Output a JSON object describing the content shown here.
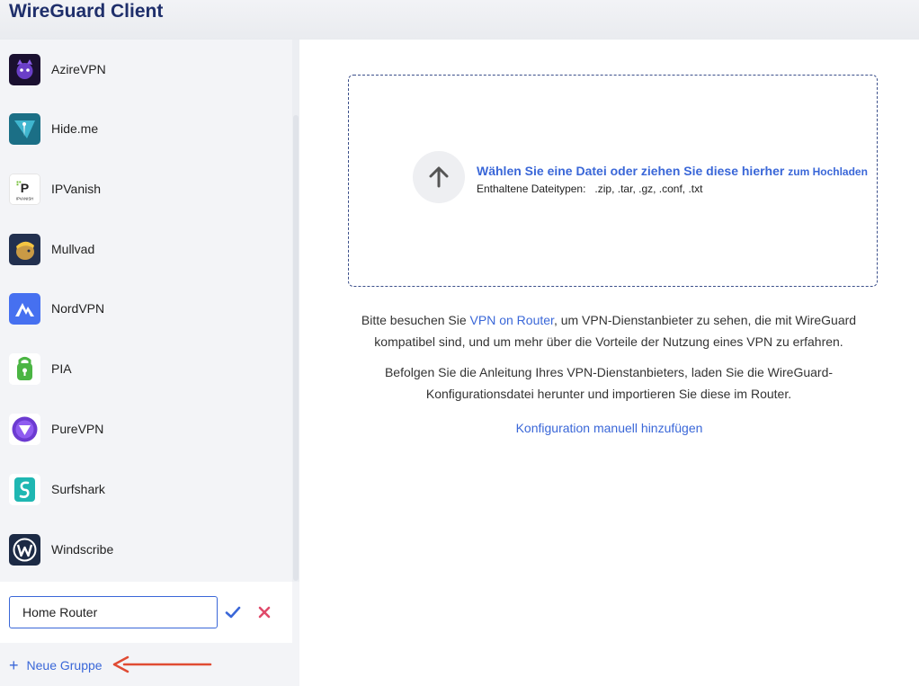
{
  "app": {
    "title": "WireGuard Client"
  },
  "sidebar": {
    "providers": [
      {
        "label": "AzireVPN",
        "icon": "azirevpn-logo-icon"
      },
      {
        "label": "Hide.me",
        "icon": "hideme-logo-icon"
      },
      {
        "label": "IPVanish",
        "icon": "ipvanish-logo-icon"
      },
      {
        "label": "Mullvad",
        "icon": "mullvad-logo-icon"
      },
      {
        "label": "NordVPN",
        "icon": "nordvpn-logo-icon"
      },
      {
        "label": "PIA",
        "icon": "pia-logo-icon"
      },
      {
        "label": "PureVPN",
        "icon": "purevpn-logo-icon"
      },
      {
        "label": "Surfshark",
        "icon": "surfshark-logo-icon"
      },
      {
        "label": "Windscribe",
        "icon": "windscribe-logo-icon"
      }
    ],
    "ipvanish_logo_text": "IPVANISH",
    "group_edit": {
      "value": "Home Router",
      "confirm_icon": "check-icon",
      "cancel_icon": "close-icon"
    },
    "new_group": {
      "label": "Neue Gruppe",
      "icon": "plus-icon"
    }
  },
  "upload": {
    "icon": "arrow-up-icon",
    "line1_main": "Wählen Sie eine Datei oder ziehen Sie diese hierher",
    "line1_small": "zum Hochladen",
    "types_label": "Enthaltene Dateitypen:",
    "types": ".zip, .tar, .gz, .conf, .txt"
  },
  "info": {
    "p1_before": "Bitte besuchen Sie",
    "p1_link": "VPN on Router",
    "p1_after": ", um VPN-Dienstanbieter zu sehen, die mit WireGuard kompatibel sind, und um mehr über die Vorteile der Nutzung eines VPN zu erfahren.",
    "p2": "Befolgen Sie die Anleitung Ihres VPN-Dienstanbieters, laden Sie die WireGuard-Konfigurationsdatei herunter und importieren Sie diese im Router."
  },
  "manual_config": {
    "label": "Konfiguration manuell hinzufügen"
  },
  "colors": {
    "accent": "#3a67d8",
    "title": "#1f2f6b",
    "cancel": "#e04a6a",
    "annotation": "#e04b33"
  }
}
